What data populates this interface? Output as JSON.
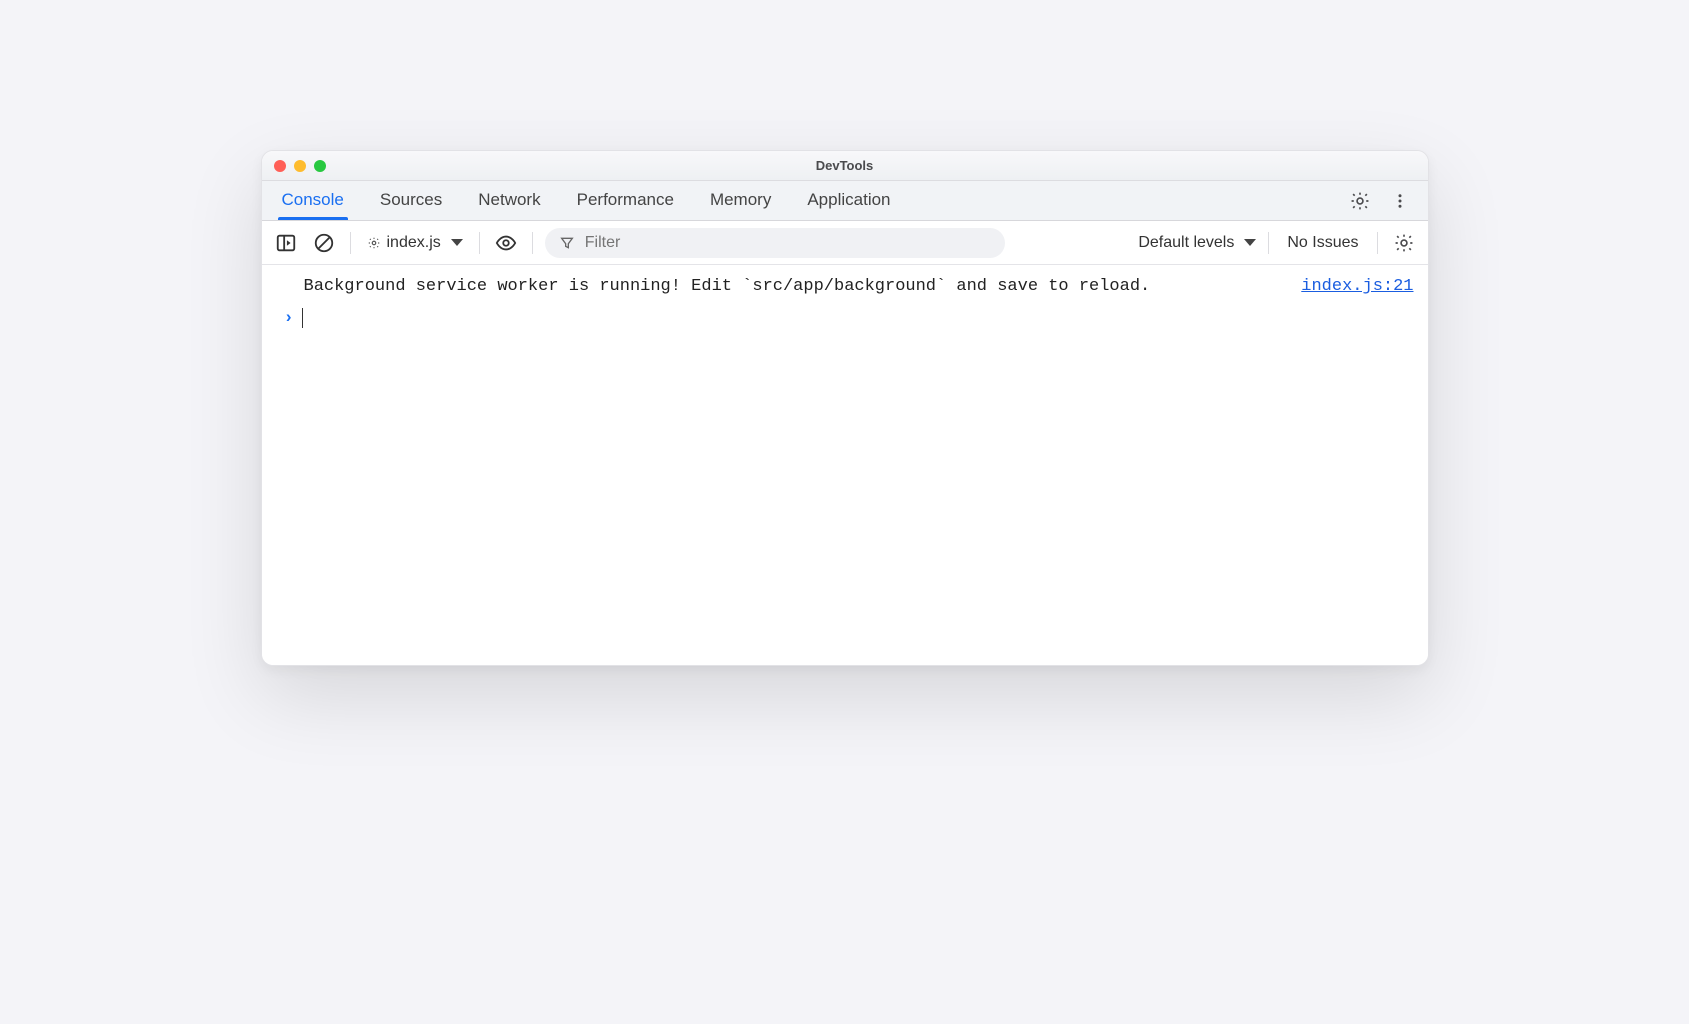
{
  "window": {
    "title": "DevTools"
  },
  "tabs": [
    {
      "label": "Console",
      "active": true
    },
    {
      "label": "Sources",
      "active": false
    },
    {
      "label": "Network",
      "active": false
    },
    {
      "label": "Performance",
      "active": false
    },
    {
      "label": "Memory",
      "active": false
    },
    {
      "label": "Application",
      "active": false
    }
  ],
  "toolbar": {
    "context": "index.js",
    "filter_placeholder": "Filter",
    "levels_label": "Default levels",
    "issues_label": "No Issues"
  },
  "console": {
    "log_message": "Background service worker is running! Edit `src/app/background` and save to reload.",
    "log_source": "index.js:21"
  },
  "colors": {
    "accent": "#1a6ff1",
    "link": "#1a5de0"
  }
}
